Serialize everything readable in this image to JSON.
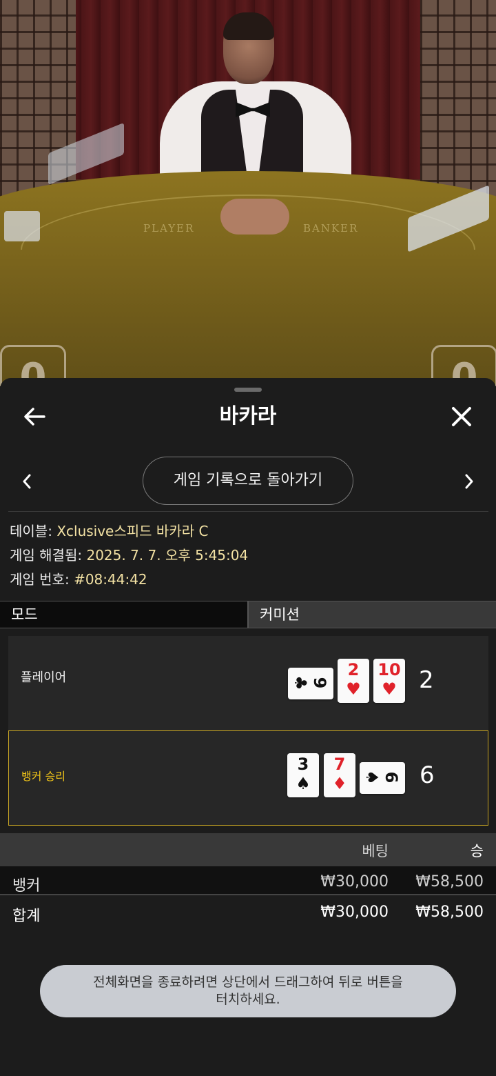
{
  "video": {
    "felt_player": "PLAYER",
    "felt_banker": "BANKER",
    "score_left": "0",
    "score_right": "0"
  },
  "header": {
    "title": "바카라"
  },
  "nav": {
    "history_button": "게임 기록으로 돌아가기"
  },
  "info": {
    "table_label": "테이블:",
    "table_value": "Xclusive스피드 바카라 C",
    "resolved_label": "게임 해결됨:",
    "resolved_value": "2025. 7. 7. 오후 5:45:04",
    "number_label": "게임 번호:",
    "number_value": "#08:44:42"
  },
  "tabs": [
    {
      "label": "모드",
      "active": true
    },
    {
      "label": "커미션",
      "active": false
    }
  ],
  "hands": {
    "player": {
      "label": "플레이어",
      "score": "2",
      "cards": [
        {
          "rank": "9",
          "suit": "♣",
          "color": "black",
          "orientation": "sideways"
        },
        {
          "rank": "2",
          "suit": "♥",
          "color": "red",
          "orientation": "upright"
        },
        {
          "rank": "10",
          "suit": "♥",
          "color": "red",
          "orientation": "upright"
        }
      ]
    },
    "banker": {
      "label": "뱅커 승리",
      "score": "6",
      "winner": true,
      "cards": [
        {
          "rank": "3",
          "suit": "♠",
          "color": "black",
          "orientation": "upright"
        },
        {
          "rank": "7",
          "suit": "♦",
          "color": "red",
          "orientation": "upright"
        },
        {
          "rank": "6",
          "suit": "♠",
          "color": "black",
          "orientation": "sideways"
        }
      ]
    }
  },
  "bets": {
    "header_bet": "베팅",
    "header_win": "승",
    "rows": [
      {
        "label": "뱅커",
        "bet": "₩30,000",
        "win": "₩58,500"
      }
    ],
    "total": {
      "label": "합계",
      "bet": "₩30,000",
      "win": "₩58,500"
    }
  },
  "toast": {
    "line1": "전체화면을 종료하려면 상단에서 드래그하여 뒤로 버튼을",
    "line2": "터치하세요."
  },
  "colors": {
    "accent_gold": "#f0c419",
    "info_value": "#f3e2a4",
    "card_red": "#e0222a",
    "sheet_bg": "#1c1c1c"
  }
}
